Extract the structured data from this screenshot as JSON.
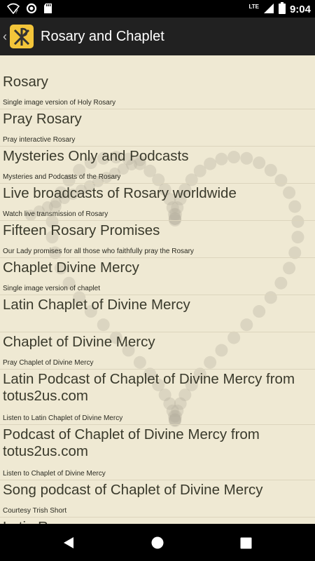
{
  "status_bar": {
    "time": "9:04",
    "network_label": "LTE",
    "icons": [
      "wifi-unknown-icon",
      "circle-sync-icon",
      "sd-card-icon",
      "signal-icon",
      "battery-icon"
    ]
  },
  "action_bar": {
    "title": "Rosary and Chaplet",
    "icon": "chi-rho-app-icon",
    "back_icon": "chevron-left-icon"
  },
  "menu": [
    {
      "title": "Rosary",
      "subtitle": "Single image version of Holy Rosary"
    },
    {
      "title": "Pray Rosary",
      "subtitle": "Pray interactive Rosary"
    },
    {
      "title": "Mysteries Only and Podcasts",
      "subtitle": "Mysteries and Podcasts of the Rosary"
    },
    {
      "title": "Live broadcasts of Rosary worldwide",
      "subtitle": "Watch live transmission of Rosary"
    },
    {
      "title": "Fifteen Rosary Promises",
      "subtitle": "Our Lady promises for all those who faithfully pray the Rosary"
    },
    {
      "title": "Chaplet Divine Mercy",
      "subtitle": "Single image version of chaplet"
    },
    {
      "title": "Latin Chaplet of Divine Mercy",
      "subtitle": ""
    },
    {
      "title": "Chaplet of Divine Mercy",
      "subtitle": "Pray Chaplet of Divine Mercy"
    },
    {
      "title": "Latin Podcast of Chaplet of Divine Mercy from totus2us.com",
      "subtitle": "Listen to Latin Chaplet of Divine Mercy"
    },
    {
      "title": "Podcast of Chaplet of Divine Mercy from totus2us.com",
      "subtitle": "Listen to Chaplet of Divine Mercy"
    },
    {
      "title": "Song podcast of Chaplet of Divine Mercy",
      "subtitle": "Courtesy Trish Short"
    },
    {
      "title": "Latin Rosary",
      "subtitle": ""
    }
  ],
  "nav_bar": {
    "icons": [
      "back-triangle-icon",
      "home-circle-icon",
      "recents-square-icon"
    ]
  }
}
